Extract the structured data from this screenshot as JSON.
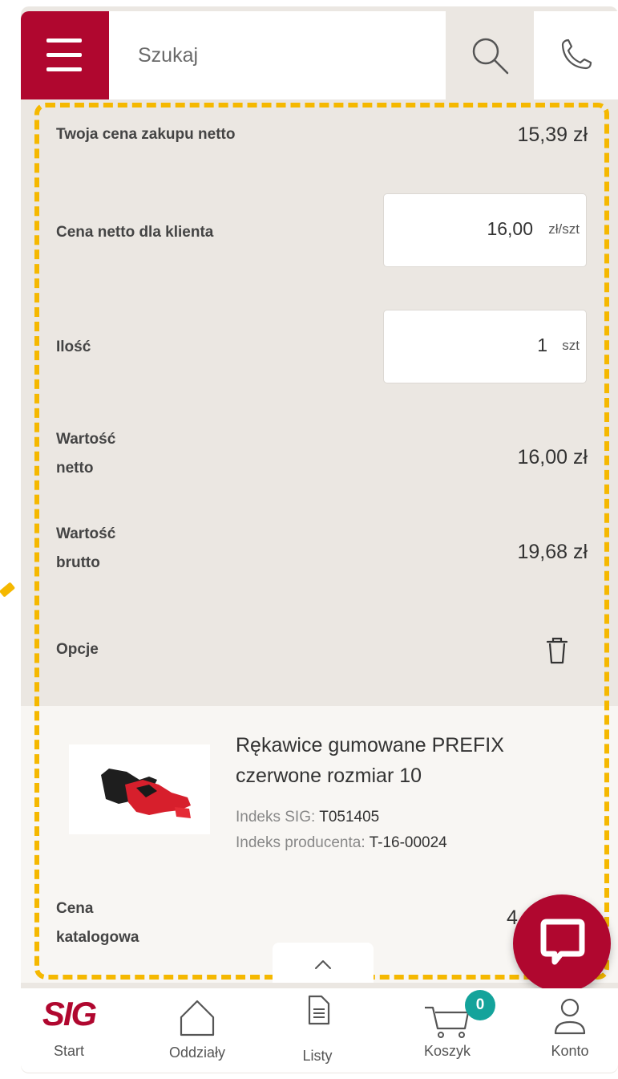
{
  "header": {
    "search_placeholder": "Szukaj",
    "icons": [
      "menu-icon",
      "search-icon",
      "phone-icon"
    ]
  },
  "pricing": {
    "purchase_label": "Twoja cena zakupu netto",
    "purchase_value": "15,39 zł",
    "client_price_label": "Cena netto dla klienta",
    "client_price_value": "16,00",
    "client_price_unit": "zł/szt",
    "qty_label": "Ilość",
    "qty_value": "1",
    "qty_unit": "szt",
    "net_label_1": "Wartość",
    "net_label_2": "netto",
    "net_value": "16,00 zł",
    "gross_label_1": "Wartość",
    "gross_label_2": "brutto",
    "gross_value": "19,68 zł",
    "options_label": "Opcje"
  },
  "product": {
    "name": "Rękawice gumowane PREFIX czerwone rozmiar 10",
    "sig_index_label": "Indeks SIG:",
    "sig_index_value": "T051405",
    "producer_index_label": "Indeks producenta:",
    "producer_index_value": "T-16-00024",
    "catalog_label_1": "Cena",
    "catalog_label_2": "katalogowa",
    "catalog_value_partial": "4"
  },
  "bottom_nav": {
    "logo_text": "SIG",
    "start": "Start",
    "branches": "Oddziały",
    "lists": "Listy",
    "cart": "Koszyk",
    "cart_count": "0",
    "account": "Konto"
  },
  "colors": {
    "brand": "#b0072f",
    "highlight": "#f5b800",
    "badge": "#14a39b",
    "panel": "#ebe7e2"
  }
}
